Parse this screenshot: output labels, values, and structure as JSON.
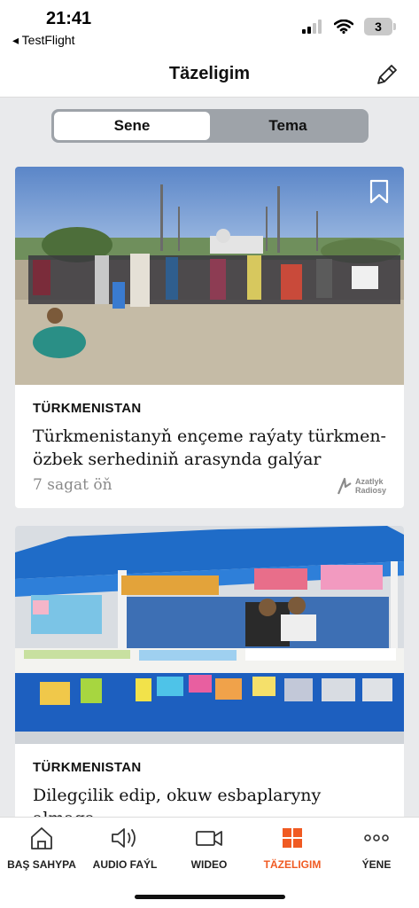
{
  "status": {
    "time": "21:41",
    "back_app": "◂ TestFlight",
    "battery": "3"
  },
  "header": {
    "title": "Täzeligim",
    "edit_icon": "pencil-icon"
  },
  "segments": [
    {
      "label": "Sene",
      "active": true
    },
    {
      "label": "Tema",
      "active": false
    }
  ],
  "articles": [
    {
      "category": "TÜRKMENISTAN",
      "title": "Türkmenistanyň ençeme raýaty türkmen-özbek serhediniň arasynda galýar",
      "time": "7 sagat öň",
      "brand_line1": "Azatlyk",
      "brand_line2": "Radiosy"
    },
    {
      "category": "TÜRKMENISTAN",
      "title": "Dilegçilik edip, okuw esbaplaryny almaga",
      "time": "",
      "brand_line1": "",
      "brand_line2": ""
    }
  ],
  "tabs": [
    {
      "label": "BAŞ SAHYPA",
      "icon": "home-icon",
      "active": false
    },
    {
      "label": "AUDIO FAÝL",
      "icon": "speaker-icon",
      "active": false
    },
    {
      "label": "WIDEO",
      "icon": "video-camera-icon",
      "active": false
    },
    {
      "label": "TÄZELIGIM",
      "icon": "grid-icon",
      "active": true
    },
    {
      "label": "ÝENE",
      "icon": "more-dots-icon",
      "active": false
    }
  ],
  "colors": {
    "accent": "#f05a22",
    "background": "#e9eaec",
    "segment_track": "#9ea3a9"
  }
}
